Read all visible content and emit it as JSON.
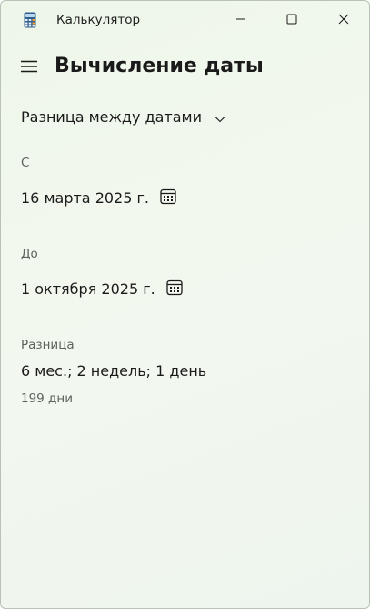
{
  "window": {
    "title": "Калькулятор",
    "controls": [
      "minimize",
      "maximize",
      "close"
    ]
  },
  "header": {
    "title": "Вычисление даты",
    "menu_icon": "hamburger-menu-icon"
  },
  "mode": {
    "selected": "Разница между датами",
    "icon": "chevron-down-icon"
  },
  "from": {
    "label": "С",
    "value": "16 марта 2025 г.",
    "icon": "calendar-icon"
  },
  "to": {
    "label": "До",
    "value": "1 октября 2025 г.",
    "icon": "calendar-icon"
  },
  "difference": {
    "label": "Разница",
    "value": "6 мес.; 2 недель; 1 день",
    "days": "199 дни"
  }
}
